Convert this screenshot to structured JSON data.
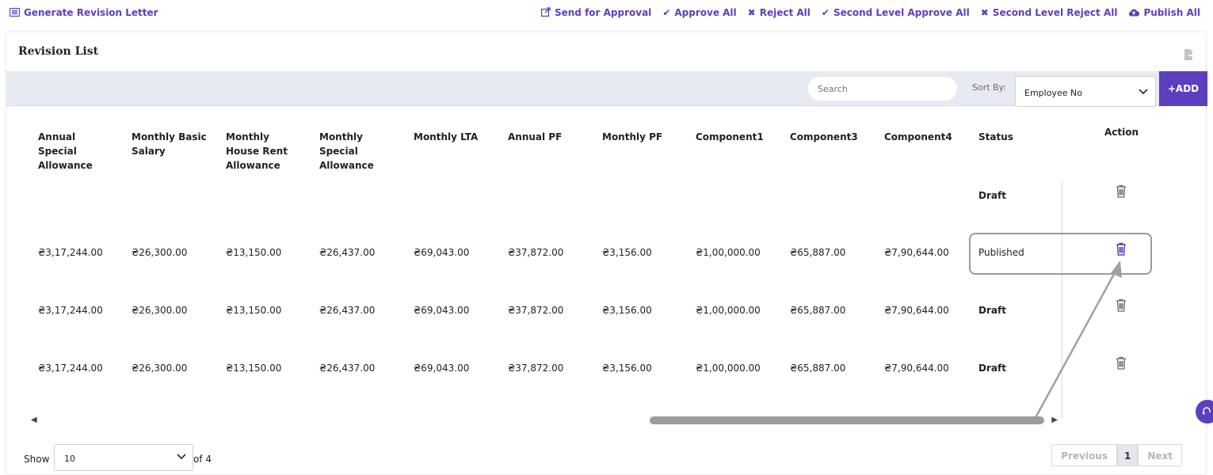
{
  "topbar": {
    "generate_letter": "Generate Revision Letter",
    "actions": [
      {
        "label": "Send for Approval",
        "icon": "share-icon"
      },
      {
        "label": "Approve All",
        "icon": "check-icon"
      },
      {
        "label": "Reject All",
        "icon": "x-icon"
      },
      {
        "label": "Second Level Approve All",
        "icon": "check-icon"
      },
      {
        "label": "Second Level Reject All",
        "icon": "x-icon"
      },
      {
        "label": "Publish All",
        "icon": "cloud-upload-icon"
      }
    ]
  },
  "card": {
    "title": "Revision List"
  },
  "toolbar": {
    "search_placeholder": "Search",
    "sort_label": "Sort By:",
    "sort_value": "Employee No",
    "add_label": "+ADD"
  },
  "table": {
    "headers": [
      "Annual Special Allowance",
      "Monthly Basic Salary",
      "Monthly House Rent Allowance",
      "Monthly Special Allowance",
      "Monthly LTA",
      "Annual PF",
      "Monthly PF",
      "Component1",
      "Component3",
      "Component4",
      "Status",
      "Action"
    ],
    "rows": [
      {
        "cells": [
          "",
          "",
          "",
          "",
          "",
          "",
          "",
          "",
          "",
          ""
        ],
        "status": "Draft"
      },
      {
        "cells": [
          "₴3,17,244.00",
          "₴26,300.00",
          "₴13,150.00",
          "₴26,437.00",
          "₴69,043.00",
          "₴37,872.00",
          "₴3,156.00",
          "₴1,00,000.00",
          "₴65,887.00",
          "₴7,90,644.00"
        ],
        "status": "Published"
      },
      {
        "cells": [
          "₴3,17,244.00",
          "₴26,300.00",
          "₴13,150.00",
          "₴26,437.00",
          "₴69,043.00",
          "₴37,872.00",
          "₴3,156.00",
          "₴1,00,000.00",
          "₴65,887.00",
          "₴7,90,644.00"
        ],
        "status": "Draft"
      },
      {
        "cells": [
          "₴3,17,244.00",
          "₴26,300.00",
          "₴13,150.00",
          "₴26,437.00",
          "₴69,043.00",
          "₴37,872.00",
          "₴3,156.00",
          "₴1,00,000.00",
          "₴65,887.00",
          "₴7,90,644.00"
        ],
        "status": "Draft"
      }
    ]
  },
  "footer": {
    "show_label": "Show",
    "page_size": "10",
    "of_label": "of 4",
    "prev_label": "Previous",
    "current_page": "1",
    "next_label": "Next"
  },
  "colors": {
    "accent": "#5b3fbf",
    "toolbar_bg": "#e8eaf3"
  }
}
